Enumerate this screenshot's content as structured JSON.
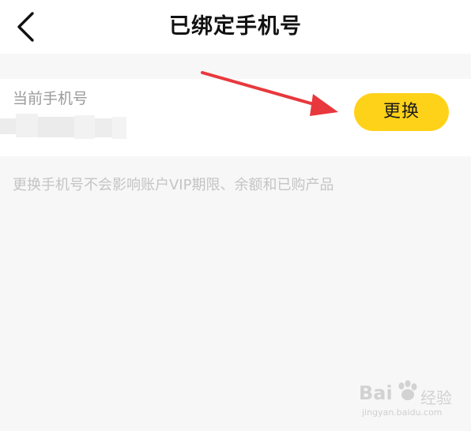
{
  "header": {
    "title": "已绑定手机号",
    "back_icon": "chevron-left-icon"
  },
  "phone_section": {
    "label": "当前手机号",
    "change_button_label": "更换"
  },
  "hint": {
    "text": "更换手机号不会影响账户VIP期限、余额和已购产品"
  },
  "watermark": {
    "logo_text": "Bai",
    "suffix_text": "经验",
    "url": "jingyan.baidu.com"
  },
  "colors": {
    "accent": "#ffd21a",
    "arrow": "#e8383d",
    "background": "#f7f7f7"
  }
}
